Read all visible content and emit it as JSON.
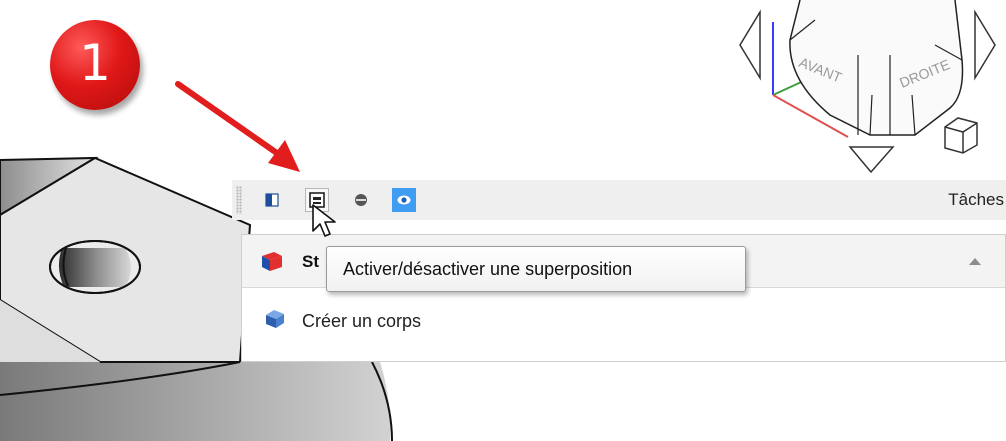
{
  "annotation": {
    "step_number": "1",
    "arrow_color": "#e21d1d"
  },
  "navigation_cube": {
    "front_label": "AVANT",
    "right_label": "DROITE"
  },
  "toolbar": {
    "buttons": [
      {
        "name": "panel-toggle-icon",
        "state": "normal"
      },
      {
        "name": "overlay-toggle-icon",
        "state": "hover",
        "tooltip": "Activer/désactiver une superposition"
      },
      {
        "name": "transparency-icon",
        "state": "normal"
      },
      {
        "name": "eye-icon",
        "state": "selected"
      }
    ],
    "tasks_label": "Tâches"
  },
  "task_panel": {
    "section_title": "St",
    "items": [
      {
        "label": "Créer un corps",
        "icon": "body-icon"
      }
    ]
  },
  "tooltip": {
    "text": "Activer/désactiver une superposition"
  },
  "colors": {
    "accent": "#3f9cf0",
    "badge_red": "#e01818",
    "toolbar_bg": "#efefef"
  }
}
